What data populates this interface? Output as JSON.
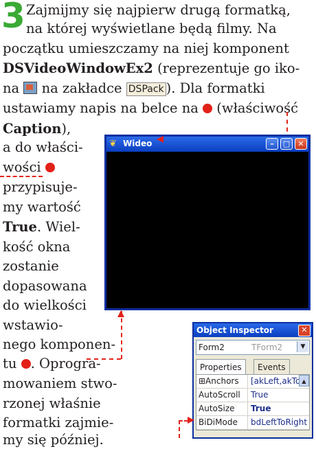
{
  "step_number": "3",
  "para": {
    "l1": "Zajmijmy się najpierw drugą formatką,",
    "l2": "na której wyświetlane będą filmy. Na",
    "l3": "początku umieszczamy na niej komponent",
    "l4_bold": "DSVideoWindowEx2",
    "l4_rest": " (reprezentuje go iko-",
    "l5_a": "na ",
    "l5_b": " na zakładce ",
    "l5_tab": "DSPack",
    "l5_c": "). Dla formatki",
    "l6_a": "ustawiamy napis na belce na ",
    "l6_b": " (właściwość",
    "l7": "Caption",
    "l7_rest": "),",
    "n1": "a do właści-",
    "n2": "wości ",
    "n3": "przypisuje-",
    "n4_a": "my wartość",
    "n5_bold": "True",
    "n5_rest": ". Wiel-",
    "n6": "kość okna",
    "n7": "zostanie",
    "n8": "dopasowana",
    "n9": "do wielkości",
    "n10": "wstawio-",
    "n11": "nego komponen-",
    "n12_a": "tu ",
    "n12_b": ". Oprogra-",
    "n13": "mowaniem stwo-",
    "n14": "rzonej właśnie",
    "n15": "formatki zajmie-",
    "n16": "my się później."
  },
  "video_window": {
    "title": "Wideo"
  },
  "object_inspector": {
    "title": "Object Inspector",
    "form_name": "Form2",
    "form_type": "TForm2",
    "tab_properties": "Properties",
    "tab_events": "Events",
    "rows": [
      {
        "key": "⊞Anchors",
        "value": "[akLeft,akTop]"
      },
      {
        "key": "AutoScroll",
        "value": "True"
      },
      {
        "key": "AutoSize",
        "value": "True"
      },
      {
        "key": "BiDiMode",
        "value": "bdLeftToRight"
      }
    ]
  },
  "colors": {
    "accent_green": "#3aaa35",
    "marker_red": "#e32119",
    "title_blue": "#0a3fc0"
  }
}
